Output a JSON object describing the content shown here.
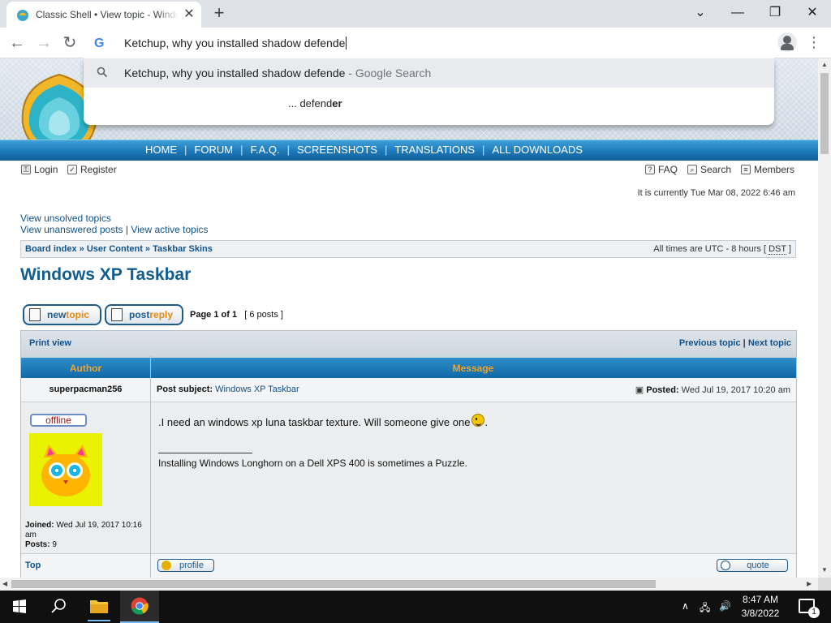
{
  "browser": {
    "tab_title": "Classic Shell • View topic - Windows XP Taskbar",
    "tab_close": "✕",
    "new_tab": "+",
    "win_minimize": "—",
    "win_restore": "❐",
    "win_close": "✕",
    "back": "←",
    "forward": "→",
    "reload": "↻",
    "omnibox_text": "Ketchup, why you installed shadow defende",
    "suggestions": [
      {
        "text": "Ketchup, why you installed shadow defende",
        "suffix": " - Google Search"
      },
      {
        "prefix": "... defend",
        "bold": "er"
      }
    ],
    "menu_icon": "⋮"
  },
  "nav": {
    "items": [
      "HOME",
      "FORUM",
      "F.A.Q.",
      "SCREENSHOTS",
      "TRANSLATIONS",
      "ALL DOWNLOADS"
    ],
    "sep": "|"
  },
  "userbar": {
    "login": "Login",
    "register": "Register",
    "faq": "FAQ",
    "search": "Search",
    "members": "Members"
  },
  "datetime": "It is currently Tue Mar 08, 2022 6:46 am",
  "links": {
    "unsolved": "View unsolved topics",
    "unanswered": "View unanswered posts",
    "sep": " | ",
    "active": "View active topics"
  },
  "breadcrumb": {
    "board": "Board index",
    "sep": " » ",
    "user_content": "User Content",
    "taskbar_skins": "Taskbar Skins",
    "timezone_prefix": "All times are UTC - 8 hours [ ",
    "dst": "DST",
    "timezone_suffix": " ]"
  },
  "topic": {
    "title": "Windows XP Taskbar",
    "new_topic_a": "new",
    "new_topic_b": "topic",
    "post_reply_a": "post",
    "post_reply_b": "reply",
    "page_info": "Page 1 of 1",
    "post_count": "[ 6 posts ]"
  },
  "table": {
    "print_view": "Print view",
    "previous_topic": "Previous topic",
    "next_sep": " | ",
    "next_topic": "Next topic",
    "author_header": "Author",
    "message_header": "Message"
  },
  "post": {
    "author": "superpacman256",
    "subject_label": "Post subject:",
    "subject": "Windows XP Taskbar",
    "posted_label": "Posted:",
    "posted_date": "Wed Jul 19, 2017 10:20 am",
    "status": "offline",
    "joined_label": "Joined:",
    "joined_date": "Wed Jul 19, 2017 10:16 am",
    "posts_label": "Posts:",
    "posts_count": "9",
    "body": ".I need an windows xp luna taskbar texture. Will someone give one",
    "body_end": ".",
    "signature": "Installing Windows Longhorn on a Dell XPS 400 is sometimes a Puzzle.",
    "top_link": "Top",
    "profile_btn": "profile",
    "quote_btn": "quote"
  },
  "taskbar": {
    "time": "8:47 AM",
    "date": "3/8/2022",
    "notification_count": "1"
  },
  "colors": {
    "nav_blue": "#1b75b5",
    "title_blue": "#115d90",
    "link_blue": "#105289",
    "header_orange": "#f0a328"
  }
}
